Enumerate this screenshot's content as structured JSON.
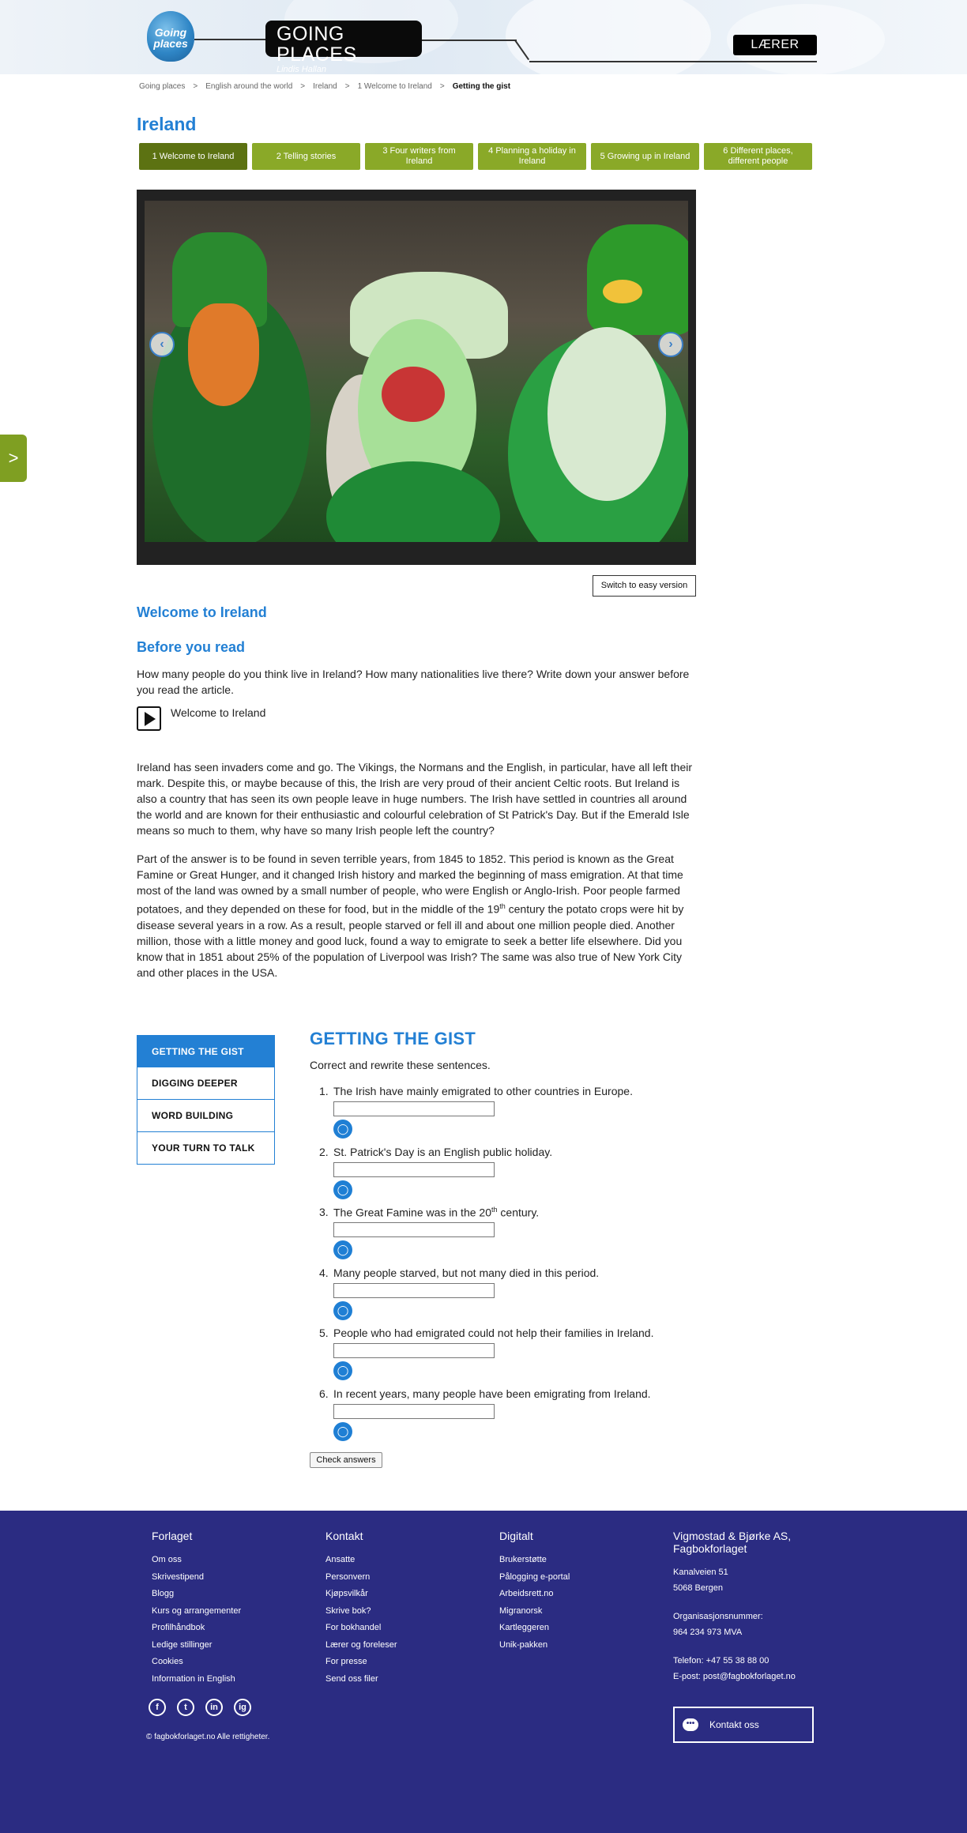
{
  "header": {
    "logo_text": "Going places",
    "title": "GOING PLACES",
    "author": "Lindis Hallan",
    "role_button": "LÆRER"
  },
  "breadcrumb": [
    "Going places",
    "English around the world",
    "Ireland",
    "1 Welcome to Ireland",
    "Getting the gist"
  ],
  "breadcrumb_sep": ">",
  "page_title": "Ireland",
  "tabs": [
    {
      "label": "1 Welcome to Ireland",
      "active": true
    },
    {
      "label": "2 Telling stories"
    },
    {
      "label": "3 Four writers from Ireland"
    },
    {
      "label": "4 Planning a holiday in Ireland"
    },
    {
      "label": "5 Growing up in Ireland"
    },
    {
      "label": "6 Different places, different people"
    }
  ],
  "slideshow": {
    "prev_icon": "‹",
    "next_icon": "›"
  },
  "side_tab_icon": ">",
  "easy_version_button": "Switch to easy version",
  "article": {
    "heading": "Welcome to Ireland",
    "before_heading": "Before you read",
    "before_text": "How many people do you think live in Ireland? How many nationalities live there? Write down your answer before you read the article.",
    "audio_label": "Welcome to Ireland",
    "p1": "Ireland has seen invaders come and go. The Vikings, the Normans and the English, in particular, have all left their mark. Despite this, or maybe because of this, the Irish are very proud of their ancient Celtic roots. But Ireland is also a country that has seen its own people leave in huge numbers. The Irish have settled in countries all around the world and are known for their enthusiastic and colourful celebration of St Patrick's Day. But if the Emerald Isle means so much to them, why have so many Irish people left the country?",
    "p2_a": "Part of the answer is to be found in seven terrible years, from 1845 to 1852. This period is known as the Great Famine or Great Hunger, and it changed Irish history and marked the beginning of mass emigration. At that time most of the land was owned by a small number of people, who were English or Anglo-Irish. Poor people farmed potatoes, and they depended on these for food, but in the middle of the 19",
    "p2_sup": "th",
    "p2_b": " century the potato crops were hit by disease several years in a row. As a result, people starved or fell ill and about one million people died. Another million, those with a little money and good luck, found a way to emigrate to seek a better life elsewhere. Did you know that in 1851 about 25% of the population of Liverpool was Irish? The same was also true of New York City and other places in the USA."
  },
  "exercise_menu": [
    "GETTING THE GIST",
    "DIGGING DEEPER",
    "WORD BUILDING",
    "YOUR TURN TO TALK"
  ],
  "exercise": {
    "title": "GETTING THE GIST",
    "instruction": "Correct and rewrite these sentences.",
    "questions": [
      {
        "num": "1.",
        "text": "The Irish have mainly emigrated to other countries in Europe."
      },
      {
        "num": "2.",
        "text": "St. Patrick's Day is an English public holiday."
      },
      {
        "num": "3.",
        "text_a": "The Great Famine was in the 20",
        "sup": "th",
        "text_b": " century."
      },
      {
        "num": "4.",
        "text": "Many people starved, but not many died in this period."
      },
      {
        "num": "5.",
        "text": "People who had emigrated could not help their families in Ireland."
      },
      {
        "num": "6.",
        "text": "In recent years, many people have been emigrating from Ireland."
      }
    ],
    "hint_icon": "lightbulb-icon",
    "check_button": "Check answers"
  },
  "footer": {
    "col1": {
      "heading": "Forlaget",
      "links": [
        "Om oss",
        "Skrivestipend",
        "Blogg",
        "Kurs og arrangementer",
        "Profilhåndbok",
        "Ledige stillinger",
        "Cookies",
        "Information in English"
      ]
    },
    "col2": {
      "heading": "Kontakt",
      "links": [
        "Ansatte",
        "Personvern",
        "Kjøpsvilkår",
        "Skrive bok?",
        "For bokhandel",
        "Lærer og foreleser",
        "For presse",
        "Send oss filer"
      ]
    },
    "col3": {
      "heading": "Digitalt",
      "links": [
        "Brukerstøtte",
        "Pålogging e-portal",
        "Arbeidsrett.no",
        "Migranorsk",
        "Kartleggeren",
        "Unik-pakken"
      ]
    },
    "col4": {
      "heading": "Vigmostad & Bjørke AS, Fagbokforlaget",
      "address1": "Kanalveien 51",
      "address2": "5068 Bergen",
      "org_label": "Organisasjonsnummer:",
      "org_number": "964 234 973 MVA",
      "phone": "Telefon: +47 55 38 88 00",
      "email": "E-post: post@fagbokforlaget.no"
    },
    "social": [
      "f",
      "t",
      "in",
      "ig"
    ],
    "copyright": "© fagbokforlaget.no Alle rettigheter.",
    "contact_button": "Kontakt oss"
  },
  "colors": {
    "accent_blue": "#2380d4",
    "tab_green": "#8aa928",
    "tab_green_active": "#5c7212",
    "footer_bg": "#2b2c82"
  }
}
